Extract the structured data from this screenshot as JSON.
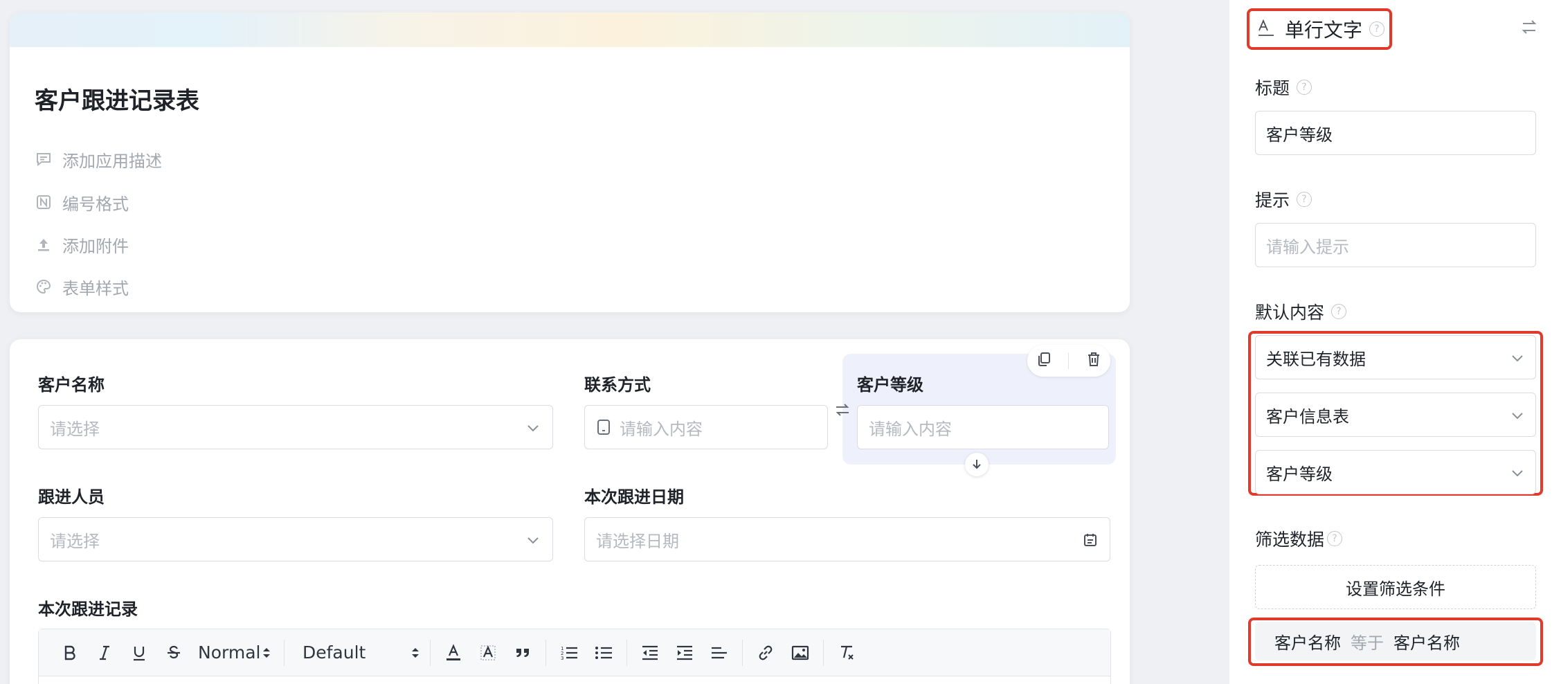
{
  "header": {
    "title": "客户跟进记录表",
    "items": [
      {
        "label": "添加应用描述",
        "icon": "comment-icon"
      },
      {
        "label": "编号格式",
        "icon": "number-format-icon"
      },
      {
        "label": "添加附件",
        "icon": "upload-icon"
      },
      {
        "label": "表单样式",
        "icon": "palette-icon"
      }
    ]
  },
  "form": {
    "fields": {
      "customer_name": {
        "label": "客户名称",
        "placeholder": "请选择"
      },
      "contact": {
        "label": "联系方式",
        "placeholder": "请输入内容"
      },
      "customer_level": {
        "label": "客户等级",
        "placeholder": "请输入内容"
      },
      "follower": {
        "label": "跟进人员",
        "placeholder": "请选择"
      },
      "follow_date": {
        "label": "本次跟进日期",
        "placeholder": "请选择日期"
      },
      "follow_record": {
        "label": "本次跟进记录"
      }
    },
    "toolbar": {
      "heading_select": "Normal",
      "font_select": "Default"
    }
  },
  "panel": {
    "field_type": "单行文字",
    "title_label": "标题",
    "title_value": "客户等级",
    "hint_label": "提示",
    "hint_placeholder": "请输入提示",
    "default_label": "默认内容",
    "default_mode": "关联已有数据",
    "linked_form": "客户信息表",
    "linked_field": "客户等级",
    "filter_label": "筛选数据",
    "filter_button": "设置筛选条件",
    "condition": {
      "left": "客户名称",
      "op": "等于",
      "right": "客户名称"
    }
  },
  "colors": {
    "accent_red": "#e03a2c",
    "selected_bg": "#eef0fb"
  }
}
